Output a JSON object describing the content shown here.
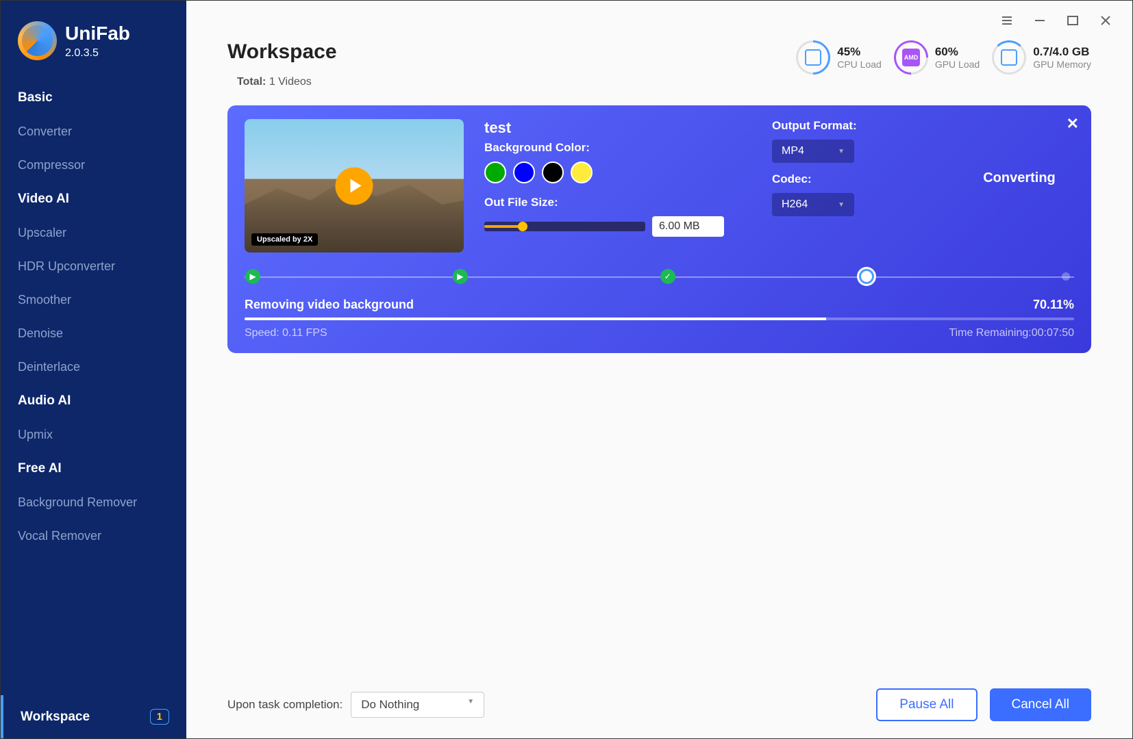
{
  "app": {
    "name": "UniFab",
    "version": "2.0.3.5"
  },
  "sidebar": {
    "sections": [
      {
        "header": "Basic",
        "items": [
          "Converter",
          "Compressor"
        ]
      },
      {
        "header": "Video AI",
        "items": [
          "Upscaler",
          "HDR Upconverter",
          "Smoother",
          "Denoise",
          "Deinterlace"
        ]
      },
      {
        "header": "Audio AI",
        "items": [
          "Upmix"
        ]
      },
      {
        "header": "Free AI",
        "items": [
          "Background Remover",
          "Vocal Remover"
        ]
      }
    ],
    "workspace": {
      "label": "Workspace",
      "badge": "1"
    }
  },
  "header": {
    "title": "Workspace",
    "total_label": "Total:",
    "total_value": "1 Videos",
    "stats": {
      "cpu": {
        "value": "45%",
        "label": "CPU Load"
      },
      "gpu": {
        "value": "60%",
        "label": "GPU Load",
        "vendor": "AMD"
      },
      "mem": {
        "value": "0.7/4.0 GB",
        "label": "GPU Memory"
      }
    }
  },
  "card": {
    "title": "test",
    "thumb_badge": "Upscaled by 2X",
    "bgcolor_label": "Background Color:",
    "filesize_label": "Out File Size:",
    "filesize_value": "6.00 MB",
    "output_format_label": "Output Format:",
    "output_format_value": "MP4",
    "codec_label": "Codec:",
    "codec_value": "H264",
    "status": "Converting",
    "progress": {
      "task": "Removing video background",
      "percent": "70.11%",
      "speed_label": "Speed: 0.11  FPS",
      "time_label": "Time Remaining:00:07:50"
    }
  },
  "footer": {
    "completion_label": "Upon task completion:",
    "completion_value": "Do Nothing",
    "pause_label": "Pause All",
    "cancel_label": "Cancel All"
  }
}
